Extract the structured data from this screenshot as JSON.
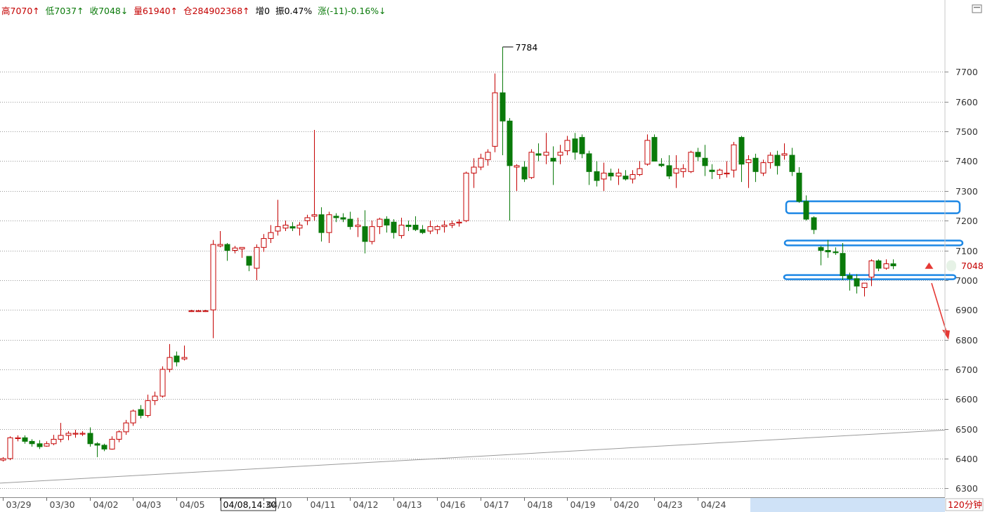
{
  "infobar": {
    "high": "高7070↑",
    "low": "低7037↑",
    "close": "收7048↓",
    "volume": "量61940↑",
    "open_interest": "仓284902368↑",
    "increase": "增0",
    "amplitude": "振0.47%",
    "change": "涨(-11)-0.16%↓"
  },
  "colors": {
    "up": "#c40000",
    "down": "#0a7a0a",
    "grid": "#9a9a9a",
    "highlight": "#1e88e5",
    "arrow": "#e53935",
    "axis_band": "#cfe2f7"
  },
  "last_price_label": "7048",
  "peak_label": "7784",
  "period_label": "120分钟",
  "maximize_icon": "maximize-icon",
  "chart_data": {
    "type": "candlestick",
    "ylim": [
      6270,
      7890
    ],
    "yticks": [
      6300,
      6400,
      6500,
      6600,
      6700,
      6800,
      6900,
      7000,
      7100,
      7200,
      7300,
      7400,
      7500,
      7600,
      7700
    ],
    "xticks": [
      {
        "label": "03/29",
        "index": 0
      },
      {
        "label": "03/30",
        "index": 6
      },
      {
        "label": "04/02",
        "index": 12
      },
      {
        "label": "04/03",
        "index": 18
      },
      {
        "label": "04/05",
        "index": 24
      },
      {
        "label": "04/08,14:30",
        "index": 30,
        "boxed": true
      },
      {
        "label": "04/10",
        "index": 36
      },
      {
        "label": "04/11",
        "index": 42
      },
      {
        "label": "04/12",
        "index": 48
      },
      {
        "label": "04/13",
        "index": 54
      },
      {
        "label": "04/16",
        "index": 60
      },
      {
        "label": "04/17",
        "index": 66
      },
      {
        "label": "04/18",
        "index": 72
      },
      {
        "label": "04/19",
        "index": 78
      },
      {
        "label": "04/20",
        "index": 84
      },
      {
        "label": "04/23",
        "index": 90
      },
      {
        "label": "04/24",
        "index": 96
      }
    ],
    "candles": [
      [
        6395,
        6405,
        6390,
        6400
      ],
      [
        6400,
        6475,
        6395,
        6470
      ],
      [
        6470,
        6478,
        6458,
        6470
      ],
      [
        6470,
        6478,
        6450,
        6458
      ],
      [
        6458,
        6465,
        6440,
        6450
      ],
      [
        6450,
        6462,
        6432,
        6440
      ],
      [
        6442,
        6458,
        6440,
        6450
      ],
      [
        6450,
        6480,
        6445,
        6465
      ],
      [
        6465,
        6520,
        6455,
        6478
      ],
      [
        6478,
        6492,
        6462,
        6485
      ],
      [
        6483,
        6497,
        6470,
        6485
      ],
      [
        6485,
        6492,
        6476,
        6485
      ],
      [
        6485,
        6505,
        6440,
        6450
      ],
      [
        6450,
        6455,
        6405,
        6445
      ],
      [
        6445,
        6450,
        6425,
        6432
      ],
      [
        6432,
        6475,
        6430,
        6465
      ],
      [
        6465,
        6495,
        6455,
        6490
      ],
      [
        6490,
        6530,
        6480,
        6520
      ],
      [
        6520,
        6565,
        6510,
        6560
      ],
      [
        6565,
        6580,
        6535,
        6545
      ],
      [
        6545,
        6615,
        6538,
        6595
      ],
      [
        6595,
        6625,
        6580,
        6610
      ],
      [
        6610,
        6710,
        6605,
        6700
      ],
      [
        6700,
        6785,
        6690,
        6740
      ],
      [
        6745,
        6760,
        6710,
        6725
      ],
      [
        6735,
        6780,
        6730,
        6740
      ],
      [
        6895,
        6900,
        6893,
        6897
      ],
      [
        6897,
        6900,
        6893,
        6897
      ],
      [
        6897,
        6900,
        6893,
        6897
      ],
      [
        6900,
        7135,
        6805,
        7120
      ],
      [
        7115,
        7165,
        7110,
        7120
      ],
      [
        7120,
        7125,
        7065,
        7100
      ],
      [
        7100,
        7115,
        7090,
        7108
      ],
      [
        7105,
        7110,
        7075,
        7110
      ],
      [
        7080,
        7080,
        7030,
        7050
      ],
      [
        7040,
        7120,
        7000,
        7110
      ],
      [
        7110,
        7155,
        7095,
        7140
      ],
      [
        7140,
        7185,
        7125,
        7160
      ],
      [
        7165,
        7270,
        7150,
        7180
      ],
      [
        7175,
        7200,
        7165,
        7185
      ],
      [
        7180,
        7195,
        7165,
        7175
      ],
      [
        7175,
        7195,
        7150,
        7185
      ],
      [
        7200,
        7220,
        7185,
        7210
      ],
      [
        7215,
        7505,
        7200,
        7220
      ],
      [
        7220,
        7245,
        7130,
        7160
      ],
      [
        7160,
        7230,
        7125,
        7220
      ],
      [
        7215,
        7225,
        7195,
        7210
      ],
      [
        7210,
        7225,
        7195,
        7205
      ],
      [
        7205,
        7230,
        7170,
        7180
      ],
      [
        7180,
        7210,
        7145,
        7185
      ],
      [
        7180,
        7235,
        7090,
        7130
      ],
      [
        7130,
        7200,
        7120,
        7180
      ],
      [
        7180,
        7210,
        7155,
        7205
      ],
      [
        7205,
        7215,
        7160,
        7185
      ],
      [
        7195,
        7205,
        7140,
        7160
      ],
      [
        7150,
        7210,
        7140,
        7185
      ],
      [
        7185,
        7200,
        7165,
        7180
      ],
      [
        7185,
        7215,
        7165,
        7170
      ],
      [
        7170,
        7185,
        7155,
        7160
      ],
      [
        7165,
        7200,
        7155,
        7180
      ],
      [
        7170,
        7185,
        7155,
        7180
      ],
      [
        7180,
        7200,
        7160,
        7185
      ],
      [
        7185,
        7200,
        7175,
        7190
      ],
      [
        7195,
        7205,
        7180,
        7195
      ],
      [
        7200,
        7365,
        7195,
        7360
      ],
      [
        7360,
        7410,
        7310,
        7380
      ],
      [
        7380,
        7425,
        7370,
        7410
      ],
      [
        7405,
        7440,
        7385,
        7430
      ],
      [
        7450,
        7695,
        7430,
        7630
      ],
      [
        7630,
        7784,
        7420,
        7535
      ],
      [
        7535,
        7545,
        7200,
        7385
      ],
      [
        7380,
        7390,
        7300,
        7385
      ],
      [
        7380,
        7400,
        7330,
        7340
      ],
      [
        7345,
        7440,
        7340,
        7430
      ],
      [
        7425,
        7460,
        7400,
        7420
      ],
      [
        7420,
        7495,
        7390,
        7430
      ],
      [
        7410,
        7450,
        7320,
        7400
      ],
      [
        7420,
        7455,
        7390,
        7430
      ],
      [
        7435,
        7485,
        7420,
        7470
      ],
      [
        7475,
        7495,
        7405,
        7430
      ],
      [
        7480,
        7490,
        7410,
        7425
      ],
      [
        7425,
        7435,
        7320,
        7365
      ],
      [
        7365,
        7400,
        7315,
        7335
      ],
      [
        7340,
        7395,
        7300,
        7360
      ],
      [
        7360,
        7375,
        7335,
        7350
      ],
      [
        7350,
        7375,
        7320,
        7360
      ],
      [
        7350,
        7370,
        7335,
        7340
      ],
      [
        7340,
        7370,
        7325,
        7355
      ],
      [
        7355,
        7400,
        7350,
        7375
      ],
      [
        7390,
        7490,
        7385,
        7470
      ],
      [
        7480,
        7490,
        7400,
        7400
      ],
      [
        7390,
        7410,
        7380,
        7385
      ],
      [
        7385,
        7420,
        7340,
        7350
      ],
      [
        7360,
        7420,
        7310,
        7375
      ],
      [
        7365,
        7390,
        7345,
        7375
      ],
      [
        7365,
        7435,
        7360,
        7430
      ],
      [
        7430,
        7445,
        7400,
        7415
      ],
      [
        7410,
        7455,
        7350,
        7385
      ],
      [
        7370,
        7390,
        7340,
        7365
      ],
      [
        7355,
        7375,
        7340,
        7370
      ],
      [
        7360,
        7400,
        7345,
        7360
      ],
      [
        7370,
        7465,
        7345,
        7455
      ],
      [
        7480,
        7485,
        7330,
        7390
      ],
      [
        7395,
        7420,
        7310,
        7405
      ],
      [
        7410,
        7425,
        7330,
        7365
      ],
      [
        7360,
        7405,
        7350,
        7395
      ],
      [
        7395,
        7430,
        7375,
        7420
      ],
      [
        7420,
        7435,
        7355,
        7385
      ],
      [
        7420,
        7460,
        7405,
        7425
      ],
      [
        7420,
        7445,
        7350,
        7365
      ],
      [
        7360,
        7380,
        7260,
        7265
      ],
      [
        7265,
        7285,
        7200,
        7205
      ],
      [
        7210,
        7215,
        7155,
        7170
      ],
      [
        7110,
        7115,
        7050,
        7100
      ],
      [
        7100,
        7135,
        7075,
        7095
      ],
      [
        7095,
        7110,
        7085,
        7093
      ],
      [
        7090,
        7125,
        7000,
        7015
      ],
      [
        7015,
        7025,
        6965,
        7005
      ],
      [
        7005,
        7020,
        6955,
        6980
      ],
      [
        6975,
        6990,
        6945,
        6990
      ],
      [
        7010,
        7070,
        6980,
        7065
      ],
      [
        7065,
        7070,
        7030,
        7040
      ],
      [
        7040,
        7070,
        7035,
        7055
      ],
      [
        7055,
        7070,
        7037,
        7048
      ]
    ],
    "annotations": {
      "highlight_zones": [
        [
          7225,
          7265
        ],
        [
          7117,
          7133
        ],
        [
          7003,
          7017
        ]
      ],
      "ascending_trendline": {
        "from": [
          0,
          6318
        ],
        "to": [
          126,
          6490
        ]
      },
      "arrow_up_marker": {
        "index": 128,
        "price": 7038
      },
      "arrow_down": {
        "from_price": 6990,
        "to_price": 6800
      }
    }
  }
}
